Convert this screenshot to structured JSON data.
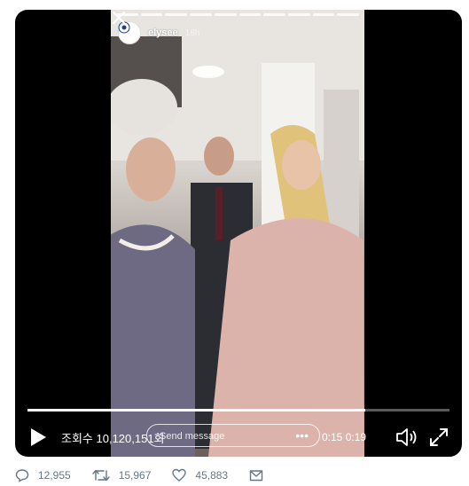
{
  "story": {
    "username": "elysee",
    "time_ago": "18h",
    "reply_placeholder": "Send message",
    "progress_segments": 10
  },
  "player": {
    "views": "조회수 10,120,151회",
    "elapsed": "0:15",
    "duration": "0:19",
    "progress_fraction": 0.8
  },
  "actions": {
    "replies": "12,955",
    "retweets": "15,967",
    "likes": "45,883"
  },
  "icons": [
    "avatar",
    "close-icon",
    "play-icon",
    "volume-icon",
    "fullscreen-icon",
    "reply-icon",
    "retweet-icon",
    "like-icon",
    "share-icon"
  ],
  "colors": {
    "player_bg": "#000000",
    "action_gray": "#657786"
  }
}
